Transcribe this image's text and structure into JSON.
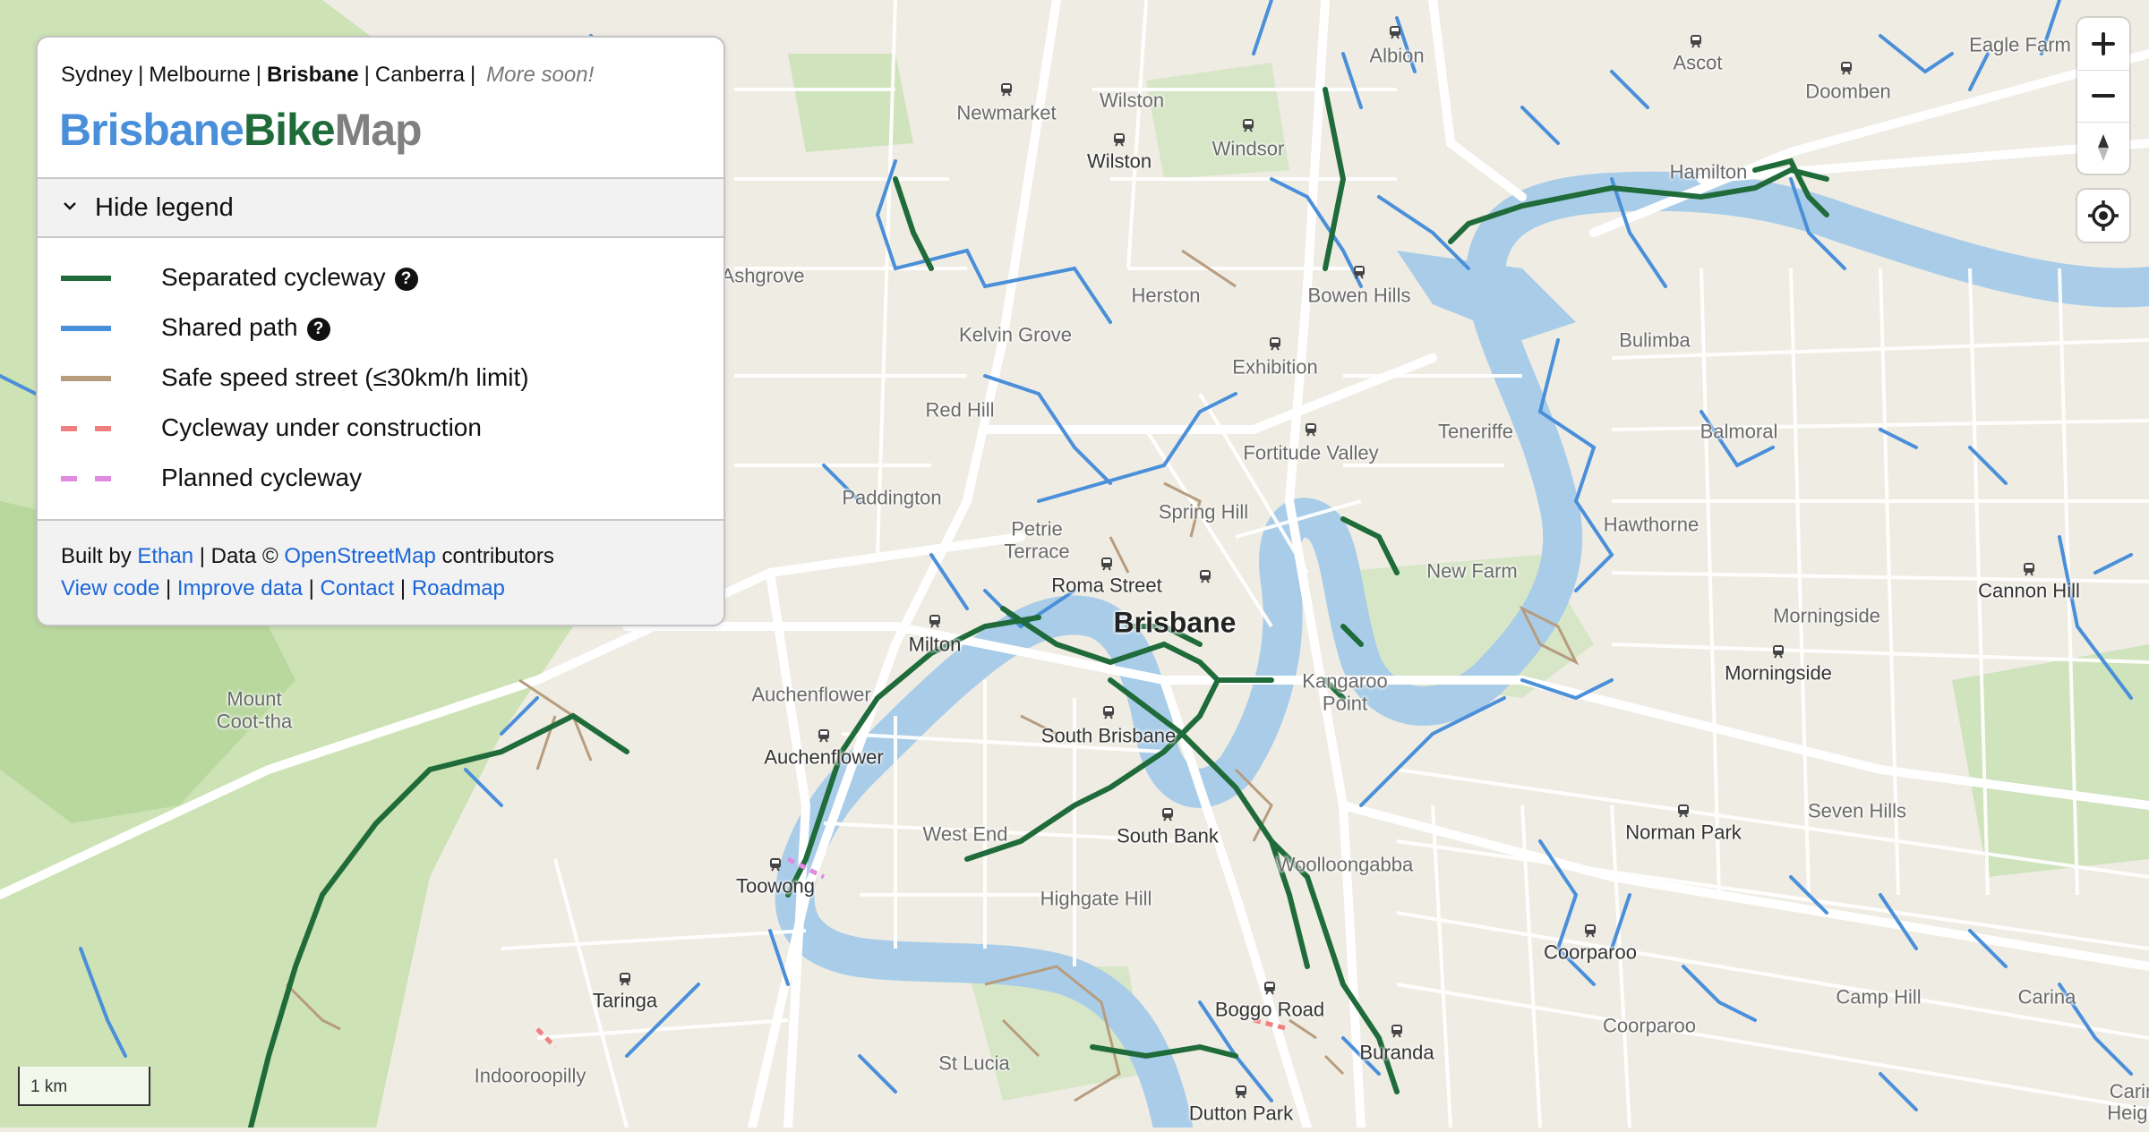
{
  "panel": {
    "cities": {
      "sydney": "Sydney",
      "melbourne": "Melbourne",
      "brisbane": "Brisbane",
      "canberra": "Canberra",
      "separator": "|",
      "more": "More soon!"
    },
    "logo": {
      "part1": "Brisbane",
      "part2": "Bike",
      "part3": "Map"
    },
    "toggle_label": "Hide legend",
    "legend": [
      {
        "label": "Separated cycleway",
        "color": "#1f6b3a",
        "style": "solid",
        "help": true
      },
      {
        "label": "Shared path",
        "color": "#4a8fd9",
        "style": "solid",
        "help": true
      },
      {
        "label": "Safe speed street (≤30km/h limit)",
        "color": "#b79c7d",
        "style": "solid",
        "help": false
      },
      {
        "label": "Cycleway under construction",
        "color": "#f08080",
        "style": "dashed",
        "help": false
      },
      {
        "label": "Planned cycleway",
        "color": "#e08ae0",
        "style": "dashed",
        "help": false
      }
    ],
    "help_glyph": "?",
    "footer": {
      "built_by": "Built by",
      "author": "Ethan",
      "data": "| Data ©",
      "osm": "OpenStreetMap",
      "contributors": "contributors",
      "links": [
        "View code",
        "Improve data",
        "Contact",
        "Roadmap"
      ],
      "separator": "|"
    }
  },
  "colors": {
    "logo_brisbane": "#4a8fd9",
    "logo_bike": "#1f6b3a",
    "logo_map": "#808080",
    "water": "#a9cde8",
    "park": "#c9dfb1",
    "land": "#efece4",
    "road": "#ffffff"
  },
  "map_labels": {
    "city": "Brisbane",
    "suburbs": [
      "Albion",
      "Ascot",
      "Eagle Farm",
      "Doomben",
      "Newmarket",
      "Wilston",
      "Windsor",
      "Hamilton",
      "Ashgrove",
      "Herston",
      "Bowen Hills",
      "Kelvin Grove",
      "Exhibition",
      "Bulimba",
      "Red Hill",
      "Fortitude Valley",
      "Teneriffe",
      "Balmoral",
      "Paddington",
      "Spring Hill",
      "Petrie Terrace",
      "Hawthorne",
      "Roma Street",
      "New Farm",
      "Cannon Hill",
      "Milton",
      "Morningside",
      "Kangaroo Point",
      "Auchenflower",
      "Mount Coot-tha",
      "South Brisbane",
      "West End",
      "South Bank",
      "Seven Hills",
      "Norman Park",
      "Toowong",
      "Woolloongabba",
      "Highgate Hill",
      "Coorparoo",
      "Camp Hill",
      "Carina",
      "Taringa",
      "Boggo Road",
      "Buranda",
      "St Lucia",
      "Indooroopilly",
      "Dutton Park",
      "Carin",
      "Heigh"
    ]
  },
  "controls": {
    "zoom_in": "zoom-in",
    "zoom_out": "zoom-out",
    "compass": "compass",
    "locate": "locate"
  },
  "scale_bar": "1 km"
}
